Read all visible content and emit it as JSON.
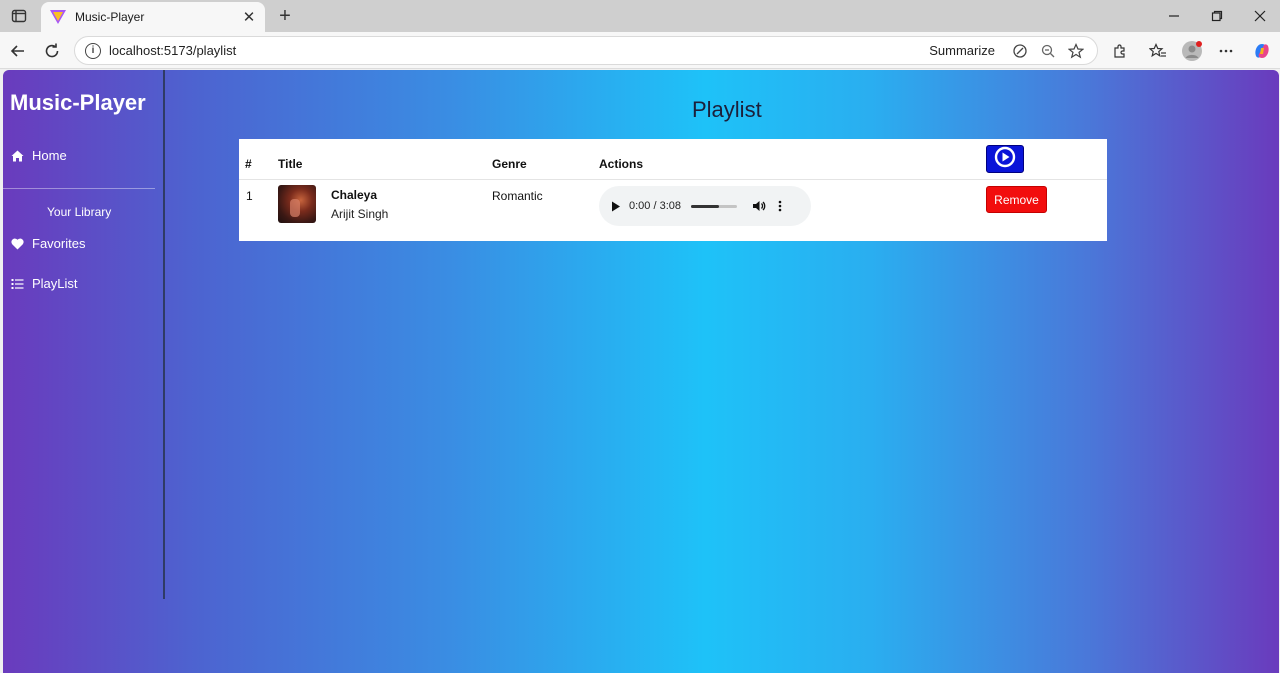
{
  "browser": {
    "tab_title": "Music-Player",
    "url": "localhost:5173/playlist",
    "summarize_label": "Summarize"
  },
  "sidebar": {
    "brand": "Music-Player",
    "home_label": "Home",
    "library_label": "Your Library",
    "favorites_label": "Favorites",
    "playlist_label": "PlayList"
  },
  "main": {
    "title": "Playlist",
    "table": {
      "headers": [
        "#",
        "Title",
        "Genre",
        "Actions"
      ],
      "rows": [
        {
          "index": "1",
          "title": "Chaleya",
          "artist": "Arijit Singh",
          "genre": "Romantic",
          "audio_time": "0:00 / 3:08",
          "volume_level": 0.6,
          "remove_label": "Remove"
        }
      ]
    }
  },
  "colors": {
    "play_all_button": "#0a14d8",
    "remove_button": "#f20d0d",
    "gradient_edge": "#6a3bbd",
    "gradient_center": "#1ec2f8"
  }
}
